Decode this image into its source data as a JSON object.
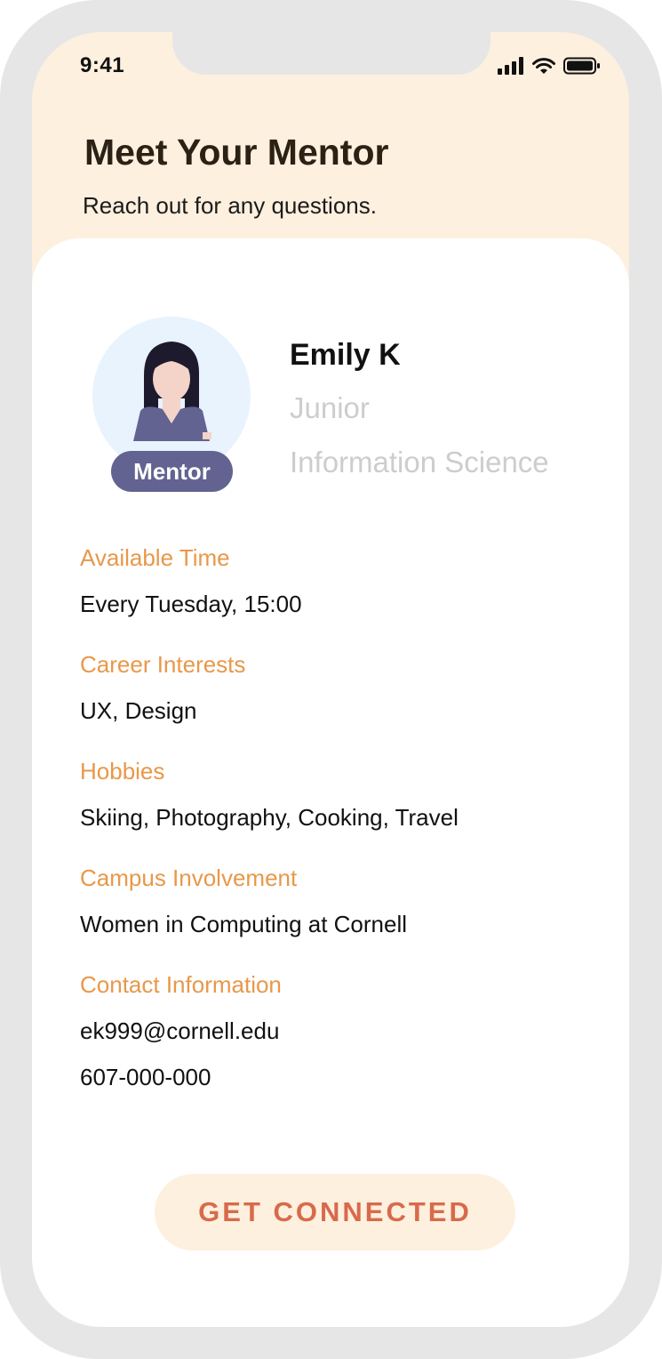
{
  "status_bar": {
    "time": "9:41"
  },
  "header": {
    "title": "Meet Your Mentor",
    "subtitle": "Reach out for any questions."
  },
  "profile": {
    "badge": "Mentor",
    "name": "Emily K",
    "year": "Junior",
    "major": "Information Science"
  },
  "sections": {
    "available_time": {
      "label": "Available Time",
      "value": "Every Tuesday, 15:00"
    },
    "career_interests": {
      "label": "Career Interests",
      "value": "UX, Design"
    },
    "hobbies": {
      "label": "Hobbies",
      "value": "Skiing, Photography, Cooking, Travel"
    },
    "campus_involvement": {
      "label": "Campus Involvement",
      "value": "Women in Computing at Cornell"
    },
    "contact": {
      "label": "Contact Information",
      "email": "ek999@cornell.edu",
      "phone": "607-000-000"
    }
  },
  "button": {
    "label": "GET CONNECTED"
  },
  "icons": [
    "signal-icon",
    "wifi-icon",
    "battery-icon",
    "avatar-illustration"
  ],
  "colors": {
    "header_bg": "#fdf0de",
    "label_accent": "#e8984a",
    "button_text": "#d86a4b",
    "badge_bg": "#626390",
    "avatar_bg": "#e8f3fd",
    "muted_text": "#cdcdcd"
  }
}
